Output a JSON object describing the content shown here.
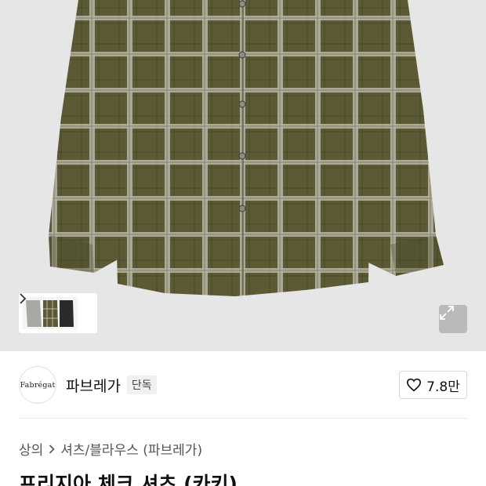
{
  "product": {
    "image_alt": "khaki check shirt",
    "thumbnail_count_hint": "3 color variants"
  },
  "brand": {
    "logo_text": "Fabrégat",
    "name": "파브레가",
    "badge": "단독"
  },
  "like": {
    "count": "7.8만"
  },
  "breadcrumb": {
    "category": "상의",
    "subcategory": "셔츠/블라우스 (파브레가)"
  },
  "title": "프리지아 체크 셔츠 (카키)",
  "colors": {
    "shirt_base": "#5b5a34",
    "shirt_check_light": "#b9b6a6",
    "background": "#e6e6e6"
  }
}
